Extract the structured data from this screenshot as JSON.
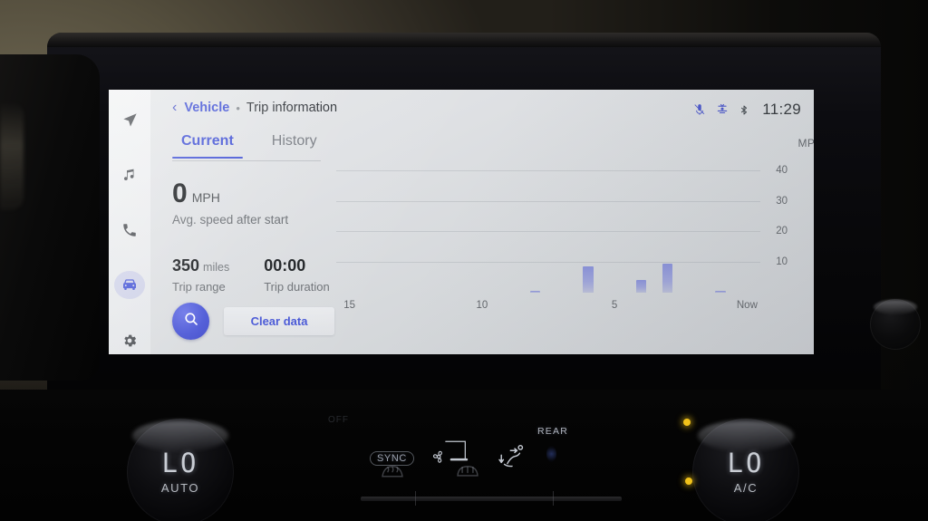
{
  "screen": {
    "statusbar": {
      "icons": [
        {
          "name": "mic-muted-icon",
          "label": "Microphone muted"
        },
        {
          "name": "gps-satellite-icon",
          "label": "GPS"
        },
        {
          "name": "bluetooth-icon",
          "label": "Bluetooth"
        }
      ],
      "clock": "11:29"
    },
    "breadcrumb": {
      "back": "‹",
      "parent": "Vehicle",
      "separator": "•",
      "current": "Trip information"
    },
    "tabs": [
      {
        "label": "Current",
        "active": true
      },
      {
        "label": "History",
        "active": false
      }
    ],
    "sidebar": {
      "items": [
        {
          "name": "navigation-icon",
          "label": "Navigation",
          "active": false
        },
        {
          "name": "music-icon",
          "label": "Media",
          "active": false
        },
        {
          "name": "phone-icon",
          "label": "Phone",
          "active": false
        },
        {
          "name": "car-icon",
          "label": "Vehicle",
          "active": true
        },
        {
          "name": "gear-icon",
          "label": "Settings",
          "active": false
        }
      ]
    },
    "stats": {
      "avg_speed_value": "0",
      "avg_speed_unit": "MPH",
      "avg_speed_label": "Avg. speed after start",
      "trip_range_value": "350",
      "trip_range_unit": "miles",
      "trip_range_label": "Trip range",
      "trip_duration_value": "00:00",
      "trip_duration_label": "Trip duration"
    },
    "actions": {
      "search_icon": "search-icon",
      "clear_data_label": "Clear data"
    },
    "accent_color": "#4656d6",
    "bar_color": "#7680d8"
  },
  "chart_data": {
    "type": "bar",
    "title": "MPG",
    "xlabel": "",
    "ylabel": "MPG",
    "ylim": [
      0,
      45
    ],
    "yticks": [
      10,
      20,
      30,
      40
    ],
    "grid": true,
    "legend": false,
    "xticks": [
      {
        "label": "15",
        "pos": 15
      },
      {
        "label": "10",
        "pos": 10
      },
      {
        "label": "5",
        "pos": 5
      },
      {
        "label": "Now",
        "pos": 0
      }
    ],
    "x": [
      15,
      14,
      13,
      12,
      11,
      10,
      9,
      8,
      7,
      6,
      5,
      4,
      3,
      2,
      1,
      0
    ],
    "values": [
      0,
      0,
      0,
      0,
      0,
      0,
      0,
      0.6,
      0,
      8.6,
      0,
      4.2,
      9.4,
      0,
      0.7,
      0
    ]
  },
  "hvac": {
    "left_knob": {
      "value": "LO",
      "mode": "AUTO",
      "name": "driver-temp-knob"
    },
    "right_knob": {
      "value": "LO",
      "mode": "A/C",
      "name": "passenger-temp-knob"
    },
    "sync_label": "SYNC",
    "rear_label": "REAR",
    "fan_icon": "fan-icon",
    "seat_airflow_icon": "seat-airflow-icon",
    "defrost_front_icon": "front-defrost-icon",
    "defrost_rear_icon": "rear-defrost-icon",
    "indicator_leds": 2
  }
}
